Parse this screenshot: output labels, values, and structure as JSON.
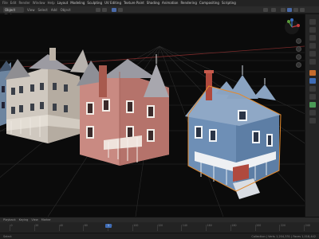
{
  "menubar": {
    "items": [
      "File",
      "Edit",
      "Render",
      "Window",
      "Help"
    ],
    "workspaces": [
      "Layout",
      "Modeling",
      "Sculpting",
      "UV Editing",
      "Texture Paint",
      "Shading",
      "Animation",
      "Rendering",
      "Compositing",
      "Scripting"
    ]
  },
  "header": {
    "mode": "Object Mode",
    "menus": [
      "View",
      "Select",
      "Add",
      "Object"
    ]
  },
  "timeline": {
    "menus": [
      "Playback",
      "Keying",
      "View",
      "Marker"
    ],
    "ticks": [
      "0",
      "20",
      "40",
      "60",
      "80",
      "100",
      "120",
      "140",
      "160",
      "180",
      "200",
      "220",
      "240"
    ],
    "current_frame": "1"
  },
  "statusbar": {
    "left": "Select",
    "right": "Collection | Verts 1,204,331 | Faces 1,018,442"
  },
  "colors": {
    "viewport_bg": "#0b0b0b",
    "grid": "#2f2f2f",
    "accent": "#3f6cb5"
  }
}
